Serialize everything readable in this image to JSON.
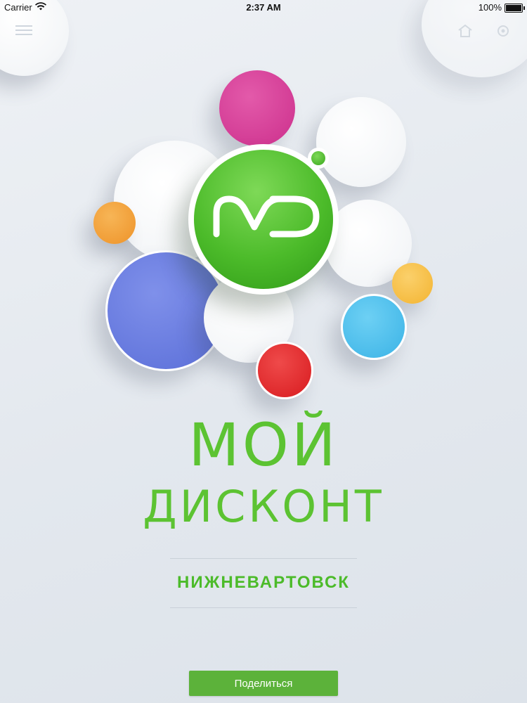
{
  "status_bar": {
    "carrier": "Carrier",
    "time": "2:37 AM",
    "battery": "100%"
  },
  "header": {
    "menu_icon": "hamburger-menu-icon",
    "right_icons": [
      "home-icon",
      "settings-icon"
    ]
  },
  "logo": {
    "letters": "MD",
    "colors": {
      "green": "#4cbb2a",
      "white": "#ffffff"
    }
  },
  "decor_colors": {
    "magenta": "#db3b9b",
    "orange": "#f3a03a",
    "blue": "#6b7fe0",
    "yellow": "#f7c14a",
    "sky": "#4fc0ee",
    "red": "#e6262c"
  },
  "brand": {
    "line1": "МОЙ",
    "line2": "ДИСКОНТ",
    "city": "НИЖНЕВАРТОВСК"
  },
  "share_button": {
    "label": "Поделиться",
    "color": "#5cb23a"
  }
}
